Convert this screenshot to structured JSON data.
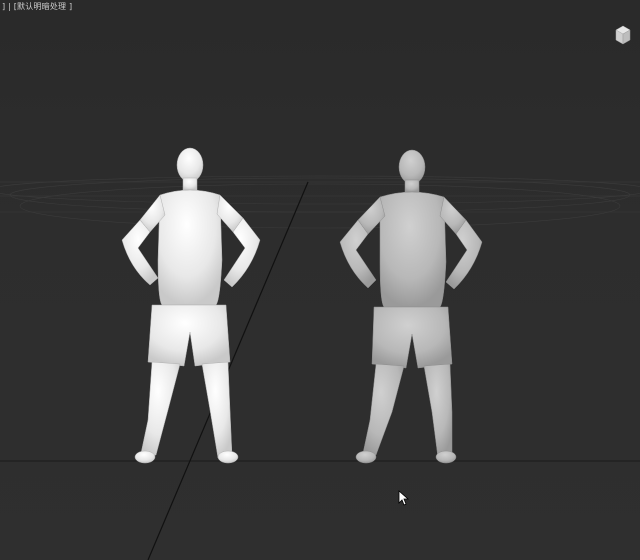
{
  "viewport": {
    "label": "] | [默认明暗处理 ]",
    "background": "#2b2b2b",
    "grid_color": "#3a3a3a",
    "grid_major_color": "#1a1a1a"
  },
  "models": [
    {
      "name": "white-player-model",
      "shading": "#f2f2f2"
    },
    {
      "name": "gray-player-model",
      "shading": "#bdbdbd"
    }
  ],
  "icons": {
    "viewcube": "viewcube-icon",
    "cursor": "mouse-cursor-icon"
  }
}
